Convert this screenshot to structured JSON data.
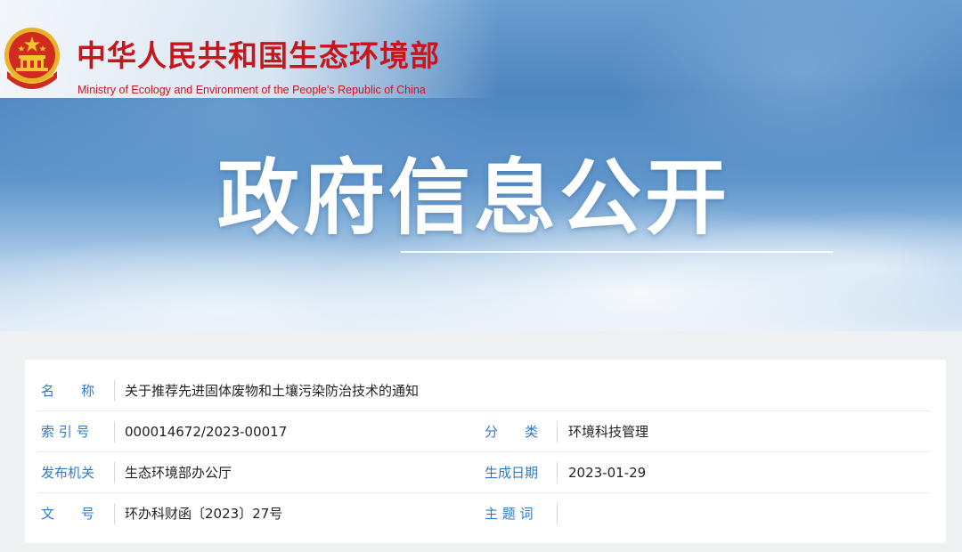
{
  "header": {
    "org_name_cn": "中华人民共和国生态环境部",
    "org_name_en": "Ministry of Ecology and Environment of the People's Republic of China",
    "emblem_icon": "national-emblem-icon",
    "brand_color": "#c8161d",
    "section_title": "政府信息公开"
  },
  "info": {
    "label_color": "#2f7ac8",
    "rows": [
      {
        "label": "名　　称",
        "value": "关于推荐先进固体废物和土壤污染防治技术的通知"
      },
      {
        "label": "索 引 号",
        "value": "000014672/2023-00017",
        "label2": "分　　类",
        "value2": "环境科技管理"
      },
      {
        "label": "发布机关",
        "value": "生态环境部办公厅",
        "label2": "生成日期",
        "value2": "2023-01-29"
      },
      {
        "label": "文　　号",
        "value": "环办科财函〔2023〕27号",
        "label2": "主 题 词",
        "value2": ""
      }
    ]
  }
}
